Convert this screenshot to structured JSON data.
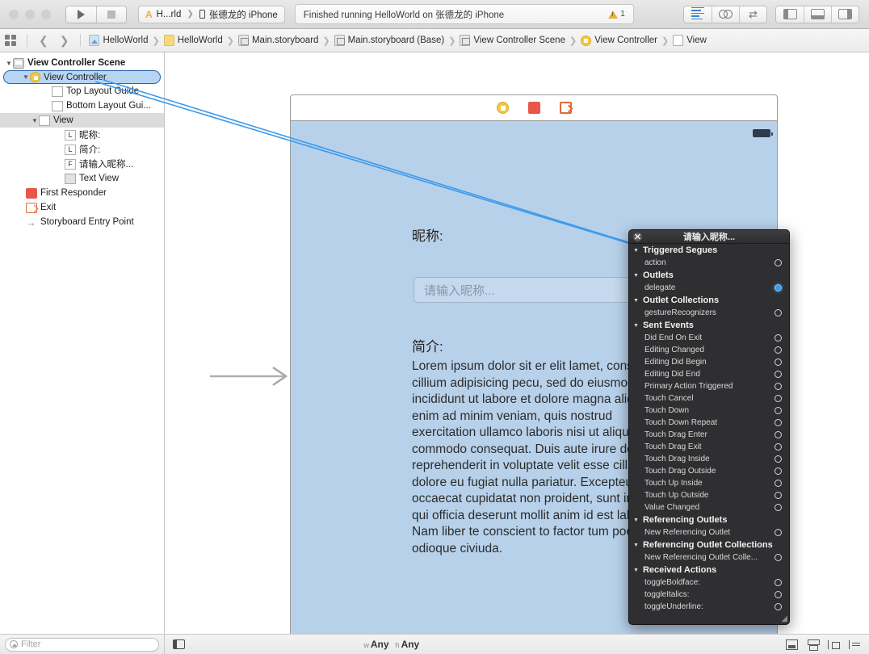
{
  "toolbar": {
    "run_label": "Run",
    "stop_label": "Stop",
    "scheme_name": "H...rld",
    "device_name": "张德龙的 iPhone",
    "status_text": "Finished running HelloWorld on 张德龙的 iPhone",
    "warning_count": "1",
    "editor_standard": "Standard Editor",
    "editor_assistant": "Assistant Editor",
    "editor_version": "Version Editor",
    "view_navigator": "Hide Navigator",
    "view_debug": "Hide Debug Area",
    "view_utilities": "Hide Utilities"
  },
  "jumpbar": {
    "related_items": "Related Items",
    "back": "Back",
    "forward": "Forward",
    "crumbs": [
      {
        "label": "HelloWorld",
        "icon": "project-icon"
      },
      {
        "label": "HelloWorld",
        "icon": "folder-icon"
      },
      {
        "label": "Main.storyboard",
        "icon": "storyboard-icon"
      },
      {
        "label": "Main.storyboard (Base)",
        "icon": "storyboard-icon"
      },
      {
        "label": "View Controller Scene",
        "icon": "scene-icon"
      },
      {
        "label": "View Controller",
        "icon": "view-controller-icon"
      },
      {
        "label": "View",
        "icon": "view-icon"
      }
    ]
  },
  "outline": {
    "rows": [
      {
        "label": "View Controller Scene",
        "indent": 0,
        "icon": "scene-icon",
        "disclosure": "open",
        "bold": true,
        "selected": false,
        "highlight": false
      },
      {
        "label": "View Controller",
        "indent": 1,
        "icon": "view-controller-icon",
        "disclosure": "open",
        "bold": false,
        "selected": true,
        "highlight": false
      },
      {
        "label": "Top Layout Guide",
        "indent": 3,
        "icon": "box-icon",
        "disclosure": "none",
        "bold": false,
        "selected": false,
        "highlight": false
      },
      {
        "label": "Bottom Layout Gui...",
        "indent": 3,
        "icon": "box-icon",
        "disclosure": "none",
        "bold": false,
        "selected": false,
        "highlight": false
      },
      {
        "label": "View",
        "indent": 2,
        "icon": "box-icon",
        "disclosure": "open",
        "bold": false,
        "selected": false,
        "highlight": true
      },
      {
        "label": "昵称:",
        "indent": 4,
        "icon": "label-icon",
        "letter": "L",
        "disclosure": "none",
        "bold": false,
        "selected": false,
        "highlight": false
      },
      {
        "label": "简介:",
        "indent": 4,
        "icon": "label-icon",
        "letter": "L",
        "disclosure": "none",
        "bold": false,
        "selected": false,
        "highlight": false
      },
      {
        "label": "请输入昵称...",
        "indent": 4,
        "icon": "textfield-icon",
        "letter": "F",
        "disclosure": "none",
        "bold": false,
        "selected": false,
        "highlight": false
      },
      {
        "label": "Text View",
        "indent": 4,
        "icon": "textview-icon",
        "disclosure": "none",
        "bold": false,
        "selected": false,
        "highlight": false
      },
      {
        "label": "First Responder",
        "indent": 1,
        "icon": "first-responder-icon",
        "disclosure": "none",
        "bold": false,
        "selected": false,
        "highlight": false
      },
      {
        "label": "Exit",
        "indent": 1,
        "icon": "exit-icon",
        "disclosure": "none",
        "bold": false,
        "selected": false,
        "highlight": false
      },
      {
        "label": "Storyboard Entry Point",
        "indent": 1,
        "icon": "entry-point-icon",
        "disclosure": "none",
        "bold": false,
        "selected": false,
        "highlight": false
      }
    ],
    "filter_placeholder": "Filter"
  },
  "canvas": {
    "dock": [
      {
        "name": "view-controller-icon"
      },
      {
        "name": "first-responder-icon"
      },
      {
        "name": "exit-icon"
      }
    ],
    "nickname_label": "昵称:",
    "textfield_placeholder": "请输入昵称...",
    "intro_label": "简介:",
    "body_text": "Lorem ipsum dolor sit er elit lamet, consectetaur cillium adipisicing pecu, sed do eiusmod tempor incididunt ut labore et dolore magna aliqua. Ut enim ad minim veniam, quis nostrud exercitation ullamco laboris nisi ut aliquip ex ea commodo consequat. Duis aute irure dolor in reprehenderit in voluptate velit esse cillum dolore eu fugiat nulla pariatur. Excepteur sint occaecat cupidatat non proident, sunt in culpa qui officia deserunt mollit anim id est laborum. Nam liber te conscient to factor tum poen legum odioque civiuda."
  },
  "connections": {
    "title": "请输入昵称...",
    "close_label": "Close",
    "groups": [
      {
        "title": "Triggered Segues",
        "items": [
          {
            "label": "action",
            "connected": false
          }
        ]
      },
      {
        "title": "Outlets",
        "items": [
          {
            "label": "delegate",
            "connected": true
          }
        ]
      },
      {
        "title": "Outlet Collections",
        "items": [
          {
            "label": "gestureRecognizers",
            "connected": false
          }
        ]
      },
      {
        "title": "Sent Events",
        "items": [
          {
            "label": "Did End On Exit",
            "connected": false
          },
          {
            "label": "Editing Changed",
            "connected": false
          },
          {
            "label": "Editing Did Begin",
            "connected": false
          },
          {
            "label": "Editing Did End",
            "connected": false
          },
          {
            "label": "Primary Action Triggered",
            "connected": false
          },
          {
            "label": "Touch Cancel",
            "connected": false
          },
          {
            "label": "Touch Down",
            "connected": false
          },
          {
            "label": "Touch Down Repeat",
            "connected": false
          },
          {
            "label": "Touch Drag Enter",
            "connected": false
          },
          {
            "label": "Touch Drag Exit",
            "connected": false
          },
          {
            "label": "Touch Drag Inside",
            "connected": false
          },
          {
            "label": "Touch Drag Outside",
            "connected": false
          },
          {
            "label": "Touch Up Inside",
            "connected": false
          },
          {
            "label": "Touch Up Outside",
            "connected": false
          },
          {
            "label": "Value Changed",
            "connected": false
          }
        ]
      },
      {
        "title": "Referencing Outlets",
        "items": [
          {
            "label": "New Referencing Outlet",
            "connected": false
          }
        ]
      },
      {
        "title": "Referencing Outlet Collections",
        "items": [
          {
            "label": "New Referencing Outlet Colle...",
            "connected": false
          }
        ]
      },
      {
        "title": "Received Actions",
        "items": [
          {
            "label": "toggleBoldface:",
            "connected": false
          },
          {
            "label": "toggleItalics:",
            "connected": false
          },
          {
            "label": "toggleUnderline:",
            "connected": false
          }
        ]
      }
    ]
  },
  "statusbar": {
    "size_class_w_prefix": "w",
    "size_class_w": "Any",
    "size_class_h_prefix": "h",
    "size_class_h": "Any",
    "icons": [
      "align-icon",
      "pin-icon",
      "resolve-icon",
      "resize-icon"
    ]
  },
  "colors": {
    "accent_blue": "#3d9aec",
    "selection_blue": "#b6d5f2",
    "selection_border": "#2a64a8",
    "device_bg": "#b8d1ea",
    "panel_bg": "#2f2f31",
    "warning_yellow": "#e8b33a"
  }
}
